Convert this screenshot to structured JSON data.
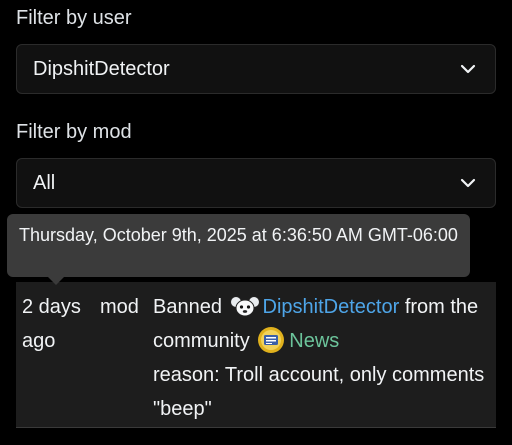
{
  "filters": {
    "user_label": "Filter by user",
    "user_value": "DipshitDetector",
    "mod_label": "Filter by mod",
    "mod_value": "All"
  },
  "tooltip": {
    "text": "Thursday, October 9th, 2025 at 6:36:50 AM GMT-06:00"
  },
  "log_entry": {
    "time": "2 days ago",
    "mod": "mod",
    "action_prefix": "Banned",
    "user_name": "DipshitDetector",
    "from_text": "from the community",
    "community": "News",
    "reason": "reason: Troll account, only comments \"beep\""
  },
  "icons": {
    "caret": "chevron-down-icon",
    "user_avatar": "mouse-avatar-icon",
    "community_icon": "news-community-icon"
  },
  "colors": {
    "background": "#000000",
    "panel": "#1d1d1d",
    "tooltip": "#3b3b3b",
    "user_link": "#4ea5e8",
    "community_link": "#6cc49b"
  }
}
